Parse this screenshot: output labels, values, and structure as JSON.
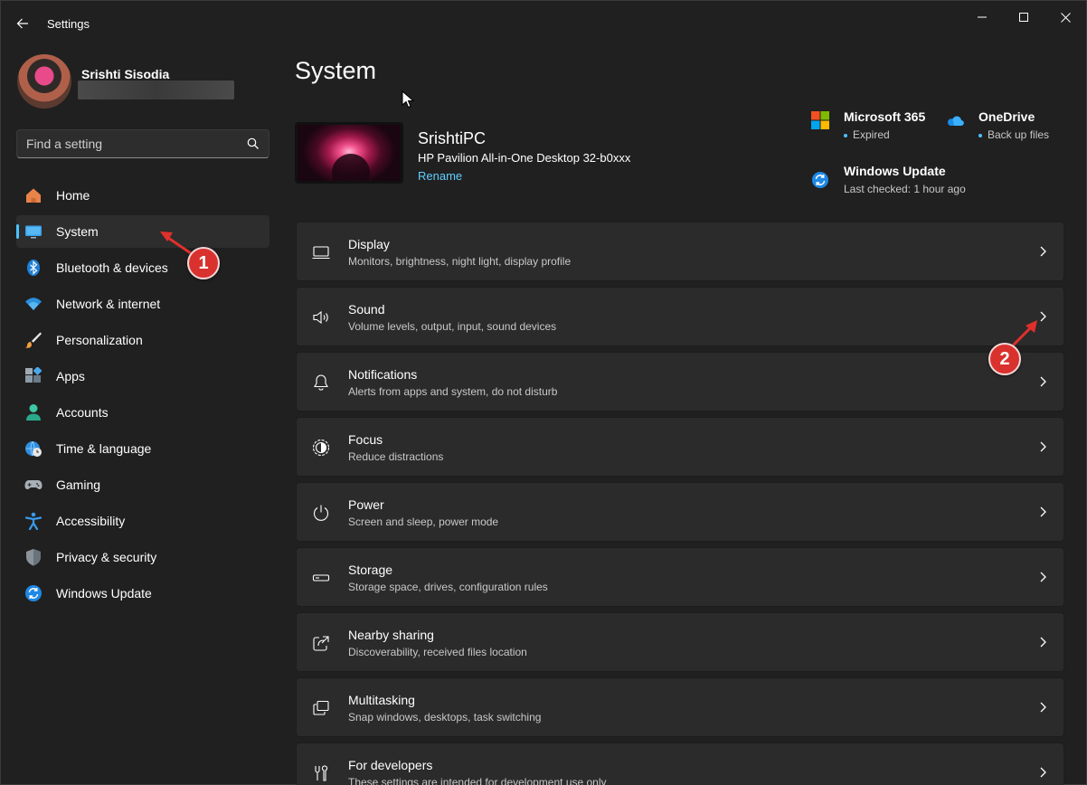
{
  "app": {
    "title": "Settings"
  },
  "user": {
    "name": "Srishti Sisodia"
  },
  "search": {
    "placeholder": "Find a setting"
  },
  "sidebar": {
    "items": [
      {
        "label": "Home",
        "icon": "home-icon"
      },
      {
        "label": "System",
        "icon": "monitor-icon",
        "active": true
      },
      {
        "label": "Bluetooth & devices",
        "icon": "bluetooth-icon"
      },
      {
        "label": "Network & internet",
        "icon": "wifi-icon"
      },
      {
        "label": "Personalization",
        "icon": "brush-icon"
      },
      {
        "label": "Apps",
        "icon": "apps-icon"
      },
      {
        "label": "Accounts",
        "icon": "person-icon"
      },
      {
        "label": "Time & language",
        "icon": "globe-clock-icon"
      },
      {
        "label": "Gaming",
        "icon": "gamepad-icon"
      },
      {
        "label": "Accessibility",
        "icon": "accessibility-icon"
      },
      {
        "label": "Privacy & security",
        "icon": "shield-icon"
      },
      {
        "label": "Windows Update",
        "icon": "update-icon"
      }
    ]
  },
  "main": {
    "title": "System",
    "device": {
      "name": "SrishtiPC",
      "model": "HP Pavilion All-in-One Desktop 32-b0xxx",
      "rename_label": "Rename"
    },
    "tiles": [
      {
        "title": "Microsoft 365",
        "status": "Expired",
        "icon": "microsoft-365-icon",
        "dot": true
      },
      {
        "title": "OneDrive",
        "status": "Back up files",
        "icon": "onedrive-icon",
        "dot": true
      },
      {
        "title": "Windows Update",
        "status": "Last checked: 1 hour ago",
        "icon": "windows-update-icon",
        "dot": false
      }
    ],
    "cards": [
      {
        "title": "Display",
        "subtitle": "Monitors, brightness, night light, display profile",
        "icon": "display-icon"
      },
      {
        "title": "Sound",
        "subtitle": "Volume levels, output, input, sound devices",
        "icon": "speaker-icon"
      },
      {
        "title": "Notifications",
        "subtitle": "Alerts from apps and system, do not disturb",
        "icon": "bell-icon"
      },
      {
        "title": "Focus",
        "subtitle": "Reduce distractions",
        "icon": "focus-icon"
      },
      {
        "title": "Power",
        "subtitle": "Screen and sleep, power mode",
        "icon": "power-icon"
      },
      {
        "title": "Storage",
        "subtitle": "Storage space, drives, configuration rules",
        "icon": "storage-icon"
      },
      {
        "title": "Nearby sharing",
        "subtitle": "Discoverability, received files location",
        "icon": "share-icon"
      },
      {
        "title": "Multitasking",
        "subtitle": "Snap windows, desktops, task switching",
        "icon": "multitasking-icon"
      },
      {
        "title": "For developers",
        "subtitle": "These settings are intended for development use only",
        "icon": "developer-tools-icon"
      }
    ]
  },
  "annotations": [
    {
      "number": "1"
    },
    {
      "number": "2"
    }
  ],
  "colors": {
    "accent": "#4cc2ff",
    "link": "#60cdff",
    "annotation": "#d9322e",
    "background": "#202020",
    "card": "#2b2b2b"
  }
}
